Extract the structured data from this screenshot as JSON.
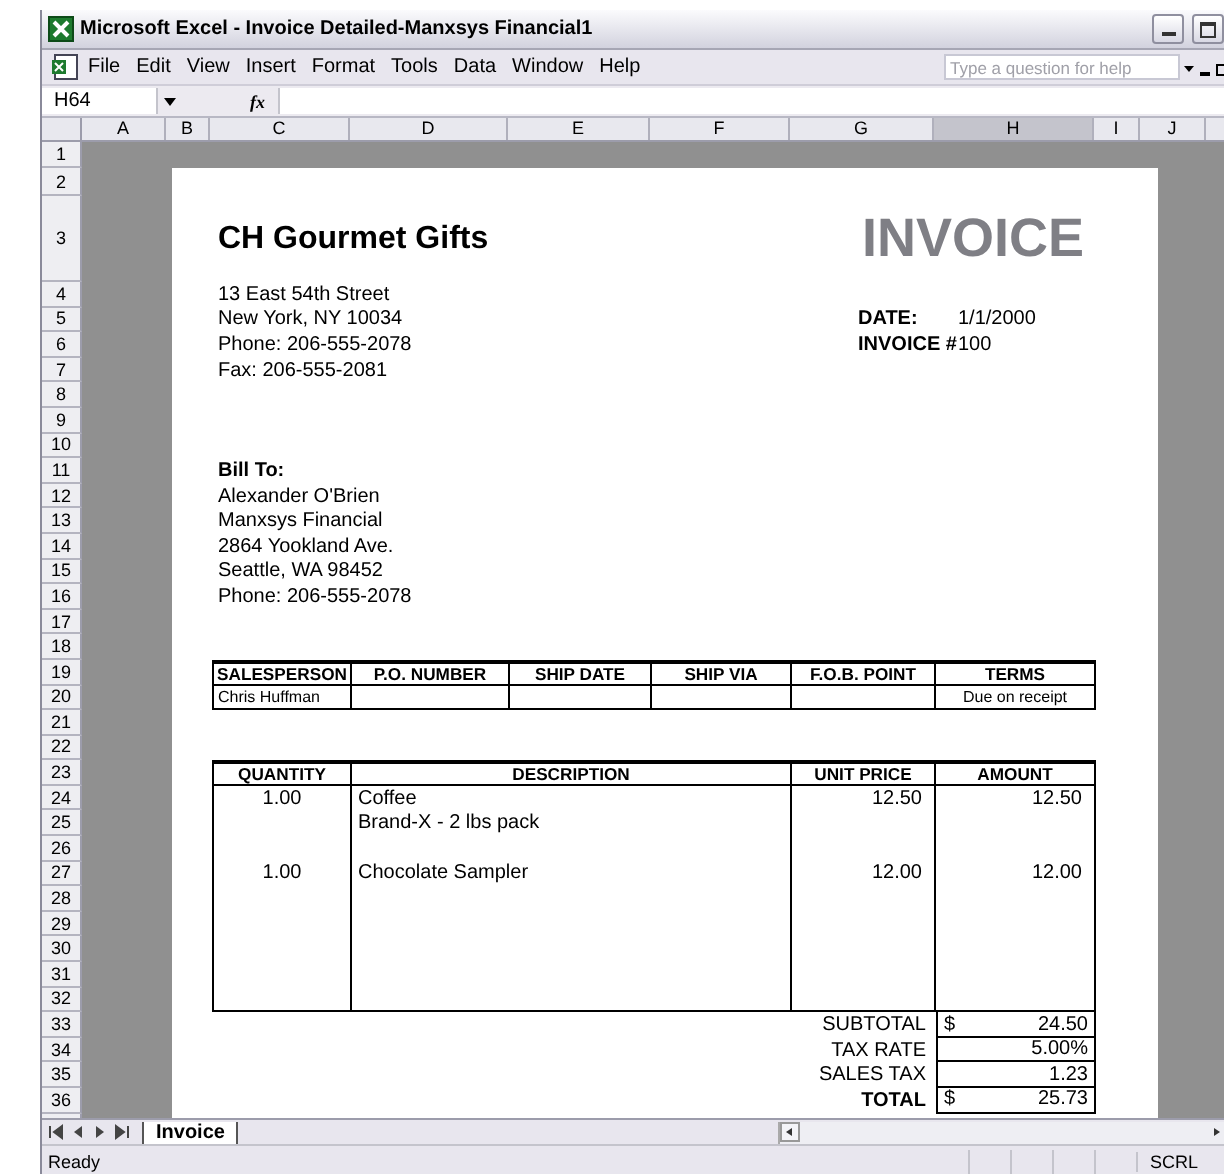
{
  "window": {
    "title": "Microsoft Excel - Invoice Detailed-Manxsys Financial1"
  },
  "menu": [
    "File",
    "Edit",
    "View",
    "Insert",
    "Format",
    "Tools",
    "Data",
    "Window",
    "Help"
  ],
  "help_box": {
    "placeholder": "Type a question for help"
  },
  "formula_bar": {
    "name_box": "H64",
    "fx": "fx"
  },
  "columns": [
    {
      "label": "A",
      "selected": false
    },
    {
      "label": "B",
      "selected": false
    },
    {
      "label": "C",
      "selected": false
    },
    {
      "label": "D",
      "selected": false
    },
    {
      "label": "E",
      "selected": false
    },
    {
      "label": "F",
      "selected": false
    },
    {
      "label": "G",
      "selected": false
    },
    {
      "label": "H",
      "selected": true
    },
    {
      "label": "I",
      "selected": false
    },
    {
      "label": "J",
      "selected": false
    }
  ],
  "rows": [
    "1",
    "2",
    "3",
    "4",
    "5",
    "6",
    "7",
    "8",
    "9",
    "10",
    "11",
    "12",
    "13",
    "14",
    "15",
    "16",
    "17",
    "18",
    "19",
    "20",
    "21",
    "22",
    "23",
    "24",
    "25",
    "26",
    "27",
    "28",
    "29",
    "30",
    "31",
    "32",
    "33",
    "34",
    "35",
    "36"
  ],
  "invoice": {
    "company": "CH Gourmet Gifts",
    "title": "INVOICE",
    "address": [
      "13 East 54th Street",
      "New York,  NY 10034",
      "Phone: 206-555-2078",
      "Fax: 206-555-2081"
    ],
    "meta": [
      {
        "label": "DATE:",
        "value": "1/1/2000"
      },
      {
        "label": "INVOICE #",
        "value": "100"
      }
    ],
    "bill_to": {
      "label": "Bill To:",
      "lines": [
        "Alexander O'Brien",
        "Manxsys Financial",
        "2864 Yookland Ave.",
        "Seattle, WA 98452",
        "Phone: 206-555-2078"
      ]
    },
    "order_table": {
      "columns": [
        "SALESPERSON",
        "P.O. NUMBER",
        "SHIP DATE",
        "SHIP VIA",
        "F.O.B. POINT",
        "TERMS"
      ],
      "salesperson": "Chris Huffman",
      "terms": "Due on receipt"
    },
    "items_table": {
      "columns": [
        "QUANTITY",
        "DESCRIPTION",
        "UNIT PRICE",
        "AMOUNT"
      ],
      "items": [
        {
          "quantity": "1.00",
          "description": [
            "Coffee",
            "Brand-X - 2 lbs pack"
          ],
          "unit_price": "12.50",
          "amount": "12.50"
        },
        {
          "quantity": "1.00",
          "description": [
            "Chocolate Sampler"
          ],
          "unit_price": "12.00",
          "amount": "12.00"
        }
      ]
    },
    "totals": [
      {
        "label": "SUBTOTAL",
        "currency": "$",
        "value": "24.50",
        "emphasis": false
      },
      {
        "label": "TAX RATE",
        "value": "5.00%",
        "emphasis": false
      },
      {
        "label": "SALES TAX",
        "value": "1.23",
        "emphasis": false
      },
      {
        "label": "TOTAL",
        "currency": "$",
        "value": "25.73",
        "emphasis": true
      }
    ]
  },
  "sheet_tabs": [
    {
      "label": "Invoice",
      "selected": true
    }
  ],
  "status_bar": {
    "text": "Ready",
    "indicators": [
      "SCRL"
    ]
  }
}
